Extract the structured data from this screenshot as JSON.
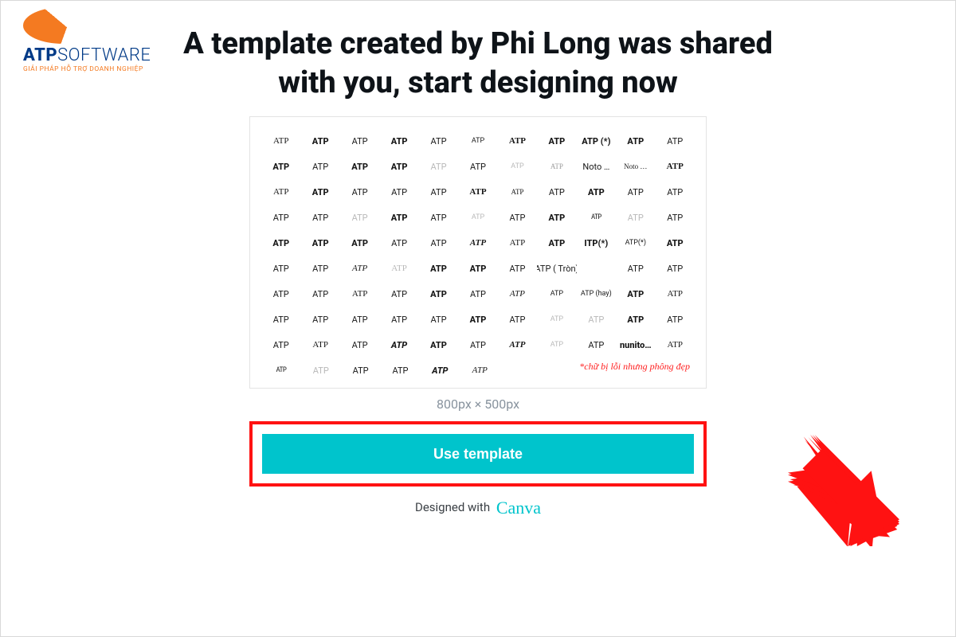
{
  "logo": {
    "brand1": "ATP",
    "brand2": "SOFTWARE",
    "tagline": "GIẢI PHÁP HỖ TRỢ DOANH NGHIỆP"
  },
  "heading": "A template created by Phi Long was shared with you, start designing now",
  "dimensions": "800px × 500px",
  "cta_label": "Use template",
  "designed_prefix": "Designed with",
  "designed_brand": "Canva",
  "preview_note": "*chữ bị lỗi nhưng phông đẹp",
  "preview_rows": [
    [
      {
        "t": "ATP",
        "c": "s"
      },
      {
        "t": "ATP",
        "c": "b"
      },
      {
        "t": "ATP",
        "c": ""
      },
      {
        "t": "ATP",
        "c": "b"
      },
      {
        "t": "ATP",
        "c": ""
      },
      {
        "t": "ATP",
        "c": "sm"
      },
      {
        "t": "ATP",
        "c": "s b"
      },
      {
        "t": "ATP",
        "c": "b"
      },
      {
        "t": "ATP (*)",
        "c": "b"
      },
      {
        "t": "ATP",
        "c": "b"
      },
      {
        "t": "ATP",
        "c": ""
      }
    ],
    [
      {
        "t": "ATP",
        "c": "b"
      },
      {
        "t": "ATP",
        "c": ""
      },
      {
        "t": "ATP",
        "c": "b"
      },
      {
        "t": "ATP",
        "c": "b"
      },
      {
        "t": "ATP",
        "c": "l"
      },
      {
        "t": "ATP",
        "c": ""
      },
      {
        "t": "ATP",
        "c": "l sm"
      },
      {
        "t": "ATP",
        "c": "sl sm"
      },
      {
        "t": "Noto …",
        "c": ""
      },
      {
        "t": "Noto …",
        "c": "s sm"
      },
      {
        "t": "ATP",
        "c": "b s"
      }
    ],
    [
      {
        "t": "ATP",
        "c": "s"
      },
      {
        "t": "ATP",
        "c": "b"
      },
      {
        "t": "ATP",
        "c": ""
      },
      {
        "t": "ATP",
        "c": ""
      },
      {
        "t": "ATP",
        "c": ""
      },
      {
        "t": "ATP",
        "c": "b s"
      },
      {
        "t": "ATP",
        "c": "s sm"
      },
      {
        "t": "ATP",
        "c": ""
      },
      {
        "t": "ATP",
        "c": "b"
      },
      {
        "t": "ATP",
        "c": ""
      },
      {
        "t": "ATP",
        "c": ""
      }
    ],
    [
      {
        "t": "ATP",
        "c": ""
      },
      {
        "t": "ATP",
        "c": ""
      },
      {
        "t": "ATP",
        "c": "l"
      },
      {
        "t": "ATP",
        "c": "b"
      },
      {
        "t": "ATP",
        "c": ""
      },
      {
        "t": "ATP",
        "c": "l sm"
      },
      {
        "t": "ATP",
        "c": ""
      },
      {
        "t": "ATP",
        "c": "b"
      },
      {
        "t": "ATP",
        "c": "nar sm"
      },
      {
        "t": "ATP",
        "c": "l"
      },
      {
        "t": "ATP",
        "c": ""
      }
    ],
    [
      {
        "t": "ATP",
        "c": "b"
      },
      {
        "t": "ATP",
        "c": "b"
      },
      {
        "t": "ATP",
        "c": "b"
      },
      {
        "t": "ATP",
        "c": ""
      },
      {
        "t": "ATP",
        "c": ""
      },
      {
        "t": "ATP",
        "c": "bi s"
      },
      {
        "t": "ATP",
        "c": "cur"
      },
      {
        "t": "ATP",
        "c": "b"
      },
      {
        "t": "ITP(*)",
        "c": "b"
      },
      {
        "t": "ATP(*)",
        "c": "sm"
      },
      {
        "t": "ATP",
        "c": "b"
      }
    ],
    [
      {
        "t": "ATP",
        "c": ""
      },
      {
        "t": "ATP",
        "c": ""
      },
      {
        "t": "ATP",
        "c": "s i"
      },
      {
        "t": "ATP",
        "c": "cur l"
      },
      {
        "t": "ATP",
        "c": "b"
      },
      {
        "t": "ATP",
        "c": "b"
      },
      {
        "t": "ATP",
        "c": ""
      },
      {
        "t": "ATP ( Tròn)",
        "c": ""
      },
      {
        "t": "",
        "c": ""
      },
      {
        "t": "ATP",
        "c": ""
      },
      {
        "t": "ATP",
        "c": ""
      }
    ],
    [
      {
        "t": "ATP",
        "c": ""
      },
      {
        "t": "ATP",
        "c": ""
      },
      {
        "t": "ATP",
        "c": "s"
      },
      {
        "t": "ATP",
        "c": ""
      },
      {
        "t": "ATP",
        "c": "b"
      },
      {
        "t": "ATP",
        "c": ""
      },
      {
        "t": "ATP",
        "c": "s i"
      },
      {
        "t": "ATP",
        "c": "sm"
      },
      {
        "t": "ATP (hay)",
        "c": "sm"
      },
      {
        "t": "ATP",
        "c": "b"
      },
      {
        "t": "ATP",
        "c": "s"
      }
    ],
    [
      {
        "t": "ATP",
        "c": ""
      },
      {
        "t": "ATP",
        "c": ""
      },
      {
        "t": "ATP",
        "c": ""
      },
      {
        "t": "ATP",
        "c": ""
      },
      {
        "t": "ATP",
        "c": ""
      },
      {
        "t": "ATP",
        "c": "b"
      },
      {
        "t": "ATP",
        "c": ""
      },
      {
        "t": "ATP",
        "c": "l sm"
      },
      {
        "t": "ATP",
        "c": "l"
      },
      {
        "t": "ATP",
        "c": "b"
      },
      {
        "t": "ATP",
        "c": ""
      }
    ],
    [
      {
        "t": "ATP",
        "c": ""
      },
      {
        "t": "ATP",
        "c": "s"
      },
      {
        "t": "ATP",
        "c": ""
      },
      {
        "t": "ATP",
        "c": "bi"
      },
      {
        "t": "ATP",
        "c": "b"
      },
      {
        "t": "ATP",
        "c": ""
      },
      {
        "t": "ATP",
        "c": "bi s"
      },
      {
        "t": "ATP",
        "c": "l sm"
      },
      {
        "t": "ATP",
        "c": ""
      },
      {
        "t": "nunito…",
        "c": "b"
      },
      {
        "t": "ATP",
        "c": "cur"
      }
    ]
  ],
  "preview_last_row": [
    {
      "t": "ATP",
      "c": "nar sm"
    },
    {
      "t": "ATP",
      "c": "l"
    },
    {
      "t": "ATP",
      "c": ""
    },
    {
      "t": "ATP",
      "c": ""
    },
    {
      "t": "ATP",
      "c": "bi"
    },
    {
      "t": "ATP",
      "c": "s i"
    }
  ]
}
